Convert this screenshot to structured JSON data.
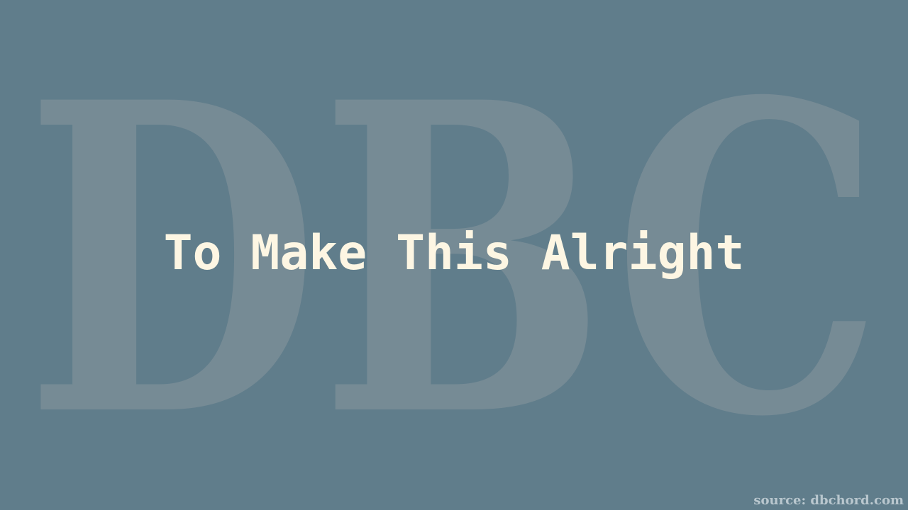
{
  "background": {
    "color": "#607d8b",
    "watermark_text": "DBC",
    "watermark_color": "#7a8d97"
  },
  "title": {
    "text": "To Make This Alright",
    "color": "#fdf6e3"
  },
  "footer": {
    "source_text": "source: dbchord.com"
  }
}
